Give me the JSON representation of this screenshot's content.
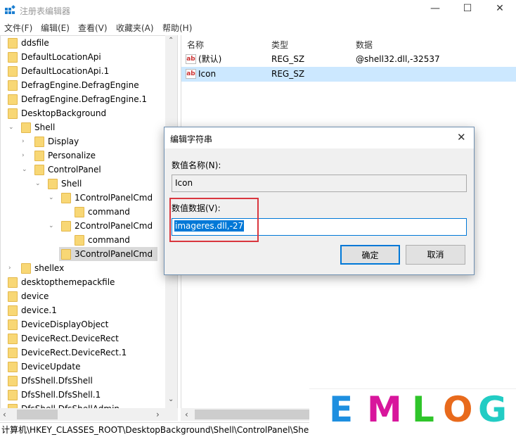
{
  "window": {
    "title": "注册表编辑器",
    "minimize": "—",
    "maximize": "☐",
    "close": "✕"
  },
  "menu": [
    "文件(F)",
    "编辑(E)",
    "查看(V)",
    "收藏夹(A)",
    "帮助(H)"
  ],
  "tree": [
    {
      "label": "ddsfile",
      "level": 0
    },
    {
      "label": "DefaultLocationApi",
      "level": 0
    },
    {
      "label": "DefaultLocationApi.1",
      "level": 0
    },
    {
      "label": "DefragEngine.DefragEngine",
      "level": 0
    },
    {
      "label": "DefragEngine.DefragEngine.1",
      "level": 0
    },
    {
      "label": "DesktopBackground",
      "level": 0
    },
    {
      "label": "Shell",
      "level": 1,
      "state": "expanded"
    },
    {
      "label": "Display",
      "level": 2,
      "state": "collapsed"
    },
    {
      "label": "Personalize",
      "level": 2,
      "state": "collapsed"
    },
    {
      "label": "ControlPanel",
      "level": 2,
      "state": "expanded"
    },
    {
      "label": "Shell",
      "level": 3,
      "state": "expanded"
    },
    {
      "label": "1ControlPanelCmd",
      "level": 4,
      "state": "expanded"
    },
    {
      "label": "command",
      "level": 5
    },
    {
      "label": "2ControlPanelCmd",
      "level": 4,
      "state": "expanded"
    },
    {
      "label": "command",
      "level": 5
    },
    {
      "label": "3ControlPanelCmd",
      "level": 4,
      "selected": true
    },
    {
      "label": "shellex",
      "level": 1,
      "state": "collapsed"
    },
    {
      "label": "desktopthemepackfile",
      "level": 0
    },
    {
      "label": "device",
      "level": 0
    },
    {
      "label": "device.1",
      "level": 0
    },
    {
      "label": "DeviceDisplayObject",
      "level": 0
    },
    {
      "label": "DeviceRect.DeviceRect",
      "level": 0
    },
    {
      "label": "DeviceRect.DeviceRect.1",
      "level": 0
    },
    {
      "label": "DeviceUpdate",
      "level": 0
    },
    {
      "label": "DfsShell.DfsShell",
      "level": 0
    },
    {
      "label": "DfsShell.DfsShell.1",
      "level": 0
    },
    {
      "label": "DfsShell.DfsShellAdmin",
      "level": 0
    }
  ],
  "values": {
    "columns": [
      "名称",
      "类型",
      "数据"
    ],
    "rows": [
      {
        "name": "(默认)",
        "type": "REG_SZ",
        "data": "@shell32.dll,-32537"
      },
      {
        "name": "Icon",
        "type": "REG_SZ",
        "data": "",
        "selected": true
      }
    ]
  },
  "status": "计算机\\HKEY_CLASSES_ROOT\\DesktopBackground\\Shell\\ControlPanel\\Shell\\",
  "logo": {
    "letters": [
      "E",
      "M",
      "L",
      "O",
      "G"
    ],
    "colors": [
      "#1e8fe0",
      "#d8169c",
      "#2fc52a",
      "#e86a1c",
      "#22ccc4"
    ]
  },
  "dialog": {
    "title": "编辑字符串",
    "name_label": "数值名称(N):",
    "name_value": "Icon",
    "data_label": "数值数据(V):",
    "data_value": "imageres.dll,-27",
    "ok": "确定",
    "cancel": "取消",
    "highlight_color": "#d9363e"
  }
}
